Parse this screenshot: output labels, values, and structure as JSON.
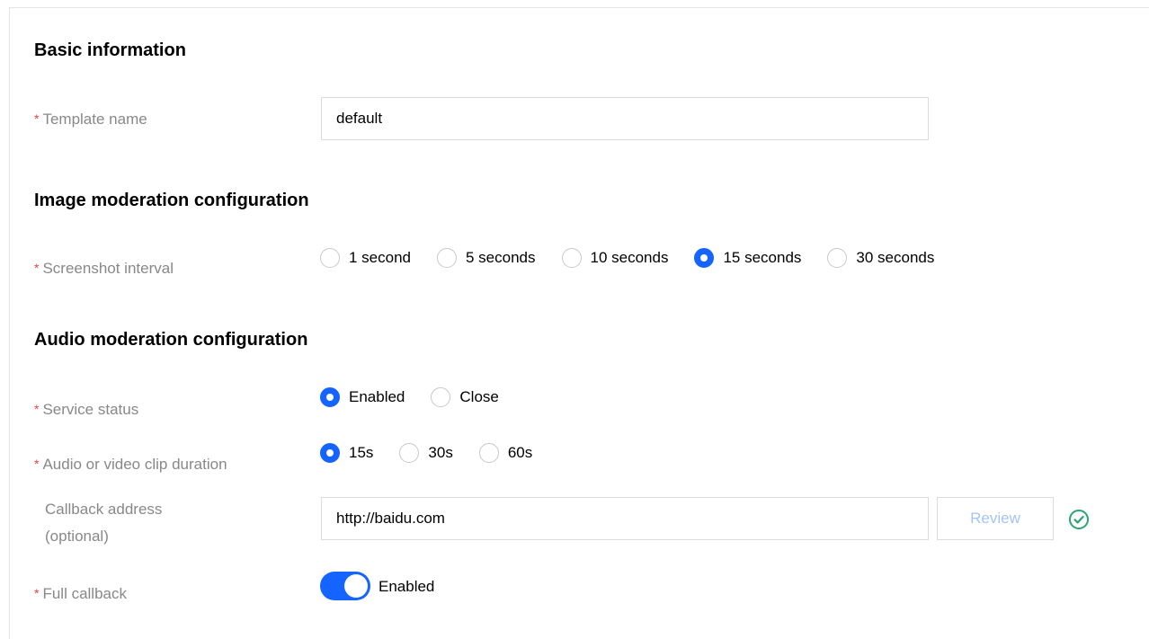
{
  "basic": {
    "title": "Basic information",
    "template_name_label": "Template name",
    "template_name_value": "default"
  },
  "image": {
    "title": "Image moderation configuration",
    "interval_label": "Screenshot interval",
    "options": [
      "1 second",
      "5 seconds",
      "10 seconds",
      "15 seconds",
      "30 seconds"
    ],
    "selected": "15 seconds"
  },
  "audio": {
    "title": "Audio moderation configuration",
    "service_status_label": "Service status",
    "service_options": [
      "Enabled",
      "Close"
    ],
    "service_selected": "Enabled",
    "clip_duration_label": "Audio or video clip duration",
    "clip_options": [
      "15s",
      "30s",
      "60s"
    ],
    "clip_selected": "15s",
    "callback_label_line1": "Callback address",
    "callback_label_line2": "(optional)",
    "callback_value": "http://baidu.com",
    "review_label": "Review",
    "callback_verified": true,
    "full_callback_label": "Full callback",
    "full_callback_state": "Enabled",
    "full_callback_on": true
  },
  "required_mark": "*",
  "colors": {
    "accent": "#1664ff",
    "required": "#e54545",
    "success": "#2ba471",
    "label": "#888888"
  }
}
